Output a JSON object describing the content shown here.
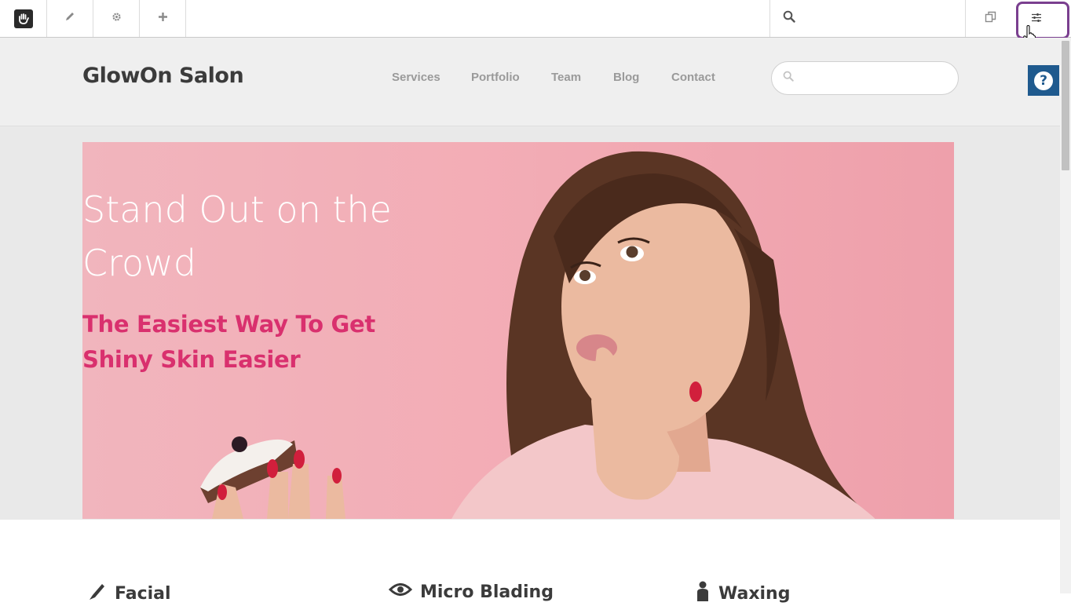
{
  "toolbar": {
    "logo_icon": "concrete-hand-icon",
    "edit_icon": "pencil-icon",
    "settings_icon": "gear-icon",
    "add_icon": "plus-icon",
    "search_icon": "search-icon",
    "search_placeholder": "",
    "pages_icon": "copy-pages-icon",
    "panels_icon": "sliders-icon"
  },
  "site": {
    "brand": "GlowOn Salon",
    "nav": [
      {
        "label": "Services"
      },
      {
        "label": "Portfolio"
      },
      {
        "label": "Team"
      },
      {
        "label": "Blog"
      },
      {
        "label": "Contact"
      }
    ],
    "search_placeholder": "",
    "help_label": "?"
  },
  "hero": {
    "title": "Stand Out on the Crowd",
    "subtitle": "The Easiest Way To Get Shiny Skin Easier"
  },
  "services": [
    {
      "label": "Facial",
      "icon": "brush-icon"
    },
    {
      "label": "Micro Blading",
      "icon": "eye-icon"
    },
    {
      "label": "Waxing",
      "icon": "person-icon"
    }
  ],
  "colors": {
    "accent_pink": "#d9306e",
    "hero_bg": "#f3adb6",
    "help_blue": "#1f5a8e",
    "highlight_purple": "#7a3f8f"
  }
}
